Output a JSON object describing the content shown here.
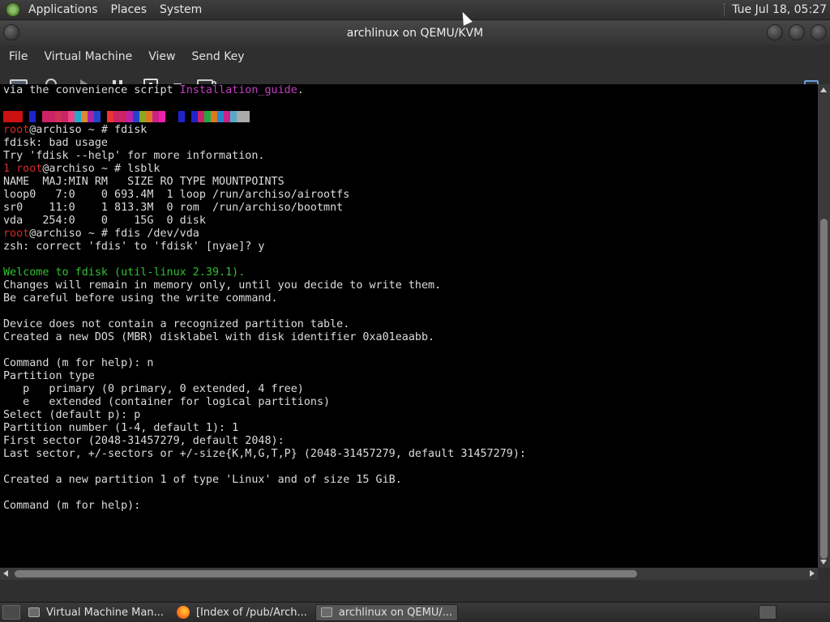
{
  "top_panel": {
    "menu": [
      "Applications",
      "Places",
      "System"
    ],
    "clock": "Tue Jul 18, 05:27"
  },
  "window": {
    "title": "archlinux on QEMU/KVM",
    "menu": [
      "File",
      "Virtual Machine",
      "View",
      "Send Key"
    ]
  },
  "toolbar": {
    "icons": [
      "monitor-icon",
      "lightbulb-icon",
      "play-icon",
      "pause-icon",
      "power-icon",
      "dropdown-caret-icon",
      "screenshot-icon",
      "fullscreen-icon"
    ]
  },
  "console": {
    "lines": [
      {
        "segments": [
          {
            "text": "via the convenience script "
          },
          {
            "text": "Installation_guide",
            "color": "magenta"
          },
          {
            "text": "."
          }
        ]
      },
      {
        "segments": [
          {
            "text": ""
          }
        ]
      },
      {
        "colorbar": [
          "#cc1111",
          "#cc1111",
          "#cc1111",
          "#000000",
          "#2222cc",
          "#000000",
          "#cc2266",
          "#cc2266",
          "#cc3355",
          "#cc2266",
          "#ee4488",
          "#22aacc",
          "#dd8833",
          "#aa22aa",
          "#2244cc",
          "#000000",
          "#ee3333",
          "#cc2266",
          "#cc2266",
          "#bb22aa",
          "#2244cc",
          "#88aa22",
          "#dd7722",
          "#cc2288",
          "#ee22aa",
          "#000000",
          "#000000",
          "#2222cc",
          "#000000",
          "#2222cc",
          "#cc2266",
          "#22aa44",
          "#dd7722",
          "#2288cc",
          "#cc2288",
          "#55aacc",
          "#aaaaaa",
          "#aaaaaa"
        ]
      },
      {
        "segments": [
          {
            "text": "root",
            "color": "red"
          },
          {
            "text": "@archiso ~ # fdisk"
          }
        ]
      },
      {
        "segments": [
          {
            "text": "fdisk: bad usage"
          }
        ]
      },
      {
        "segments": [
          {
            "text": "Try 'fdisk --help' for more information."
          }
        ]
      },
      {
        "segments": [
          {
            "text": "1 ",
            "color": "red"
          },
          {
            "text": "root",
            "color": "red"
          },
          {
            "text": "@archiso ~ # lsblk"
          }
        ]
      },
      {
        "segments": [
          {
            "text": "NAME  MAJ:MIN RM   SIZE RO TYPE MOUNTPOINTS"
          }
        ]
      },
      {
        "segments": [
          {
            "text": "loop0   7:0    0 693.4M  1 loop /run/archiso/airootfs"
          }
        ]
      },
      {
        "segments": [
          {
            "text": "sr0    11:0    1 813.3M  0 rom  /run/archiso/bootmnt"
          }
        ]
      },
      {
        "segments": [
          {
            "text": "vda   254:0    0    15G  0 disk"
          }
        ]
      },
      {
        "segments": [
          {
            "text": "root",
            "color": "red"
          },
          {
            "text": "@archiso ~ # fdis /dev/vda"
          }
        ]
      },
      {
        "segments": [
          {
            "text": "zsh: correct 'fdis' to 'fdisk' [nyae]? y"
          }
        ]
      },
      {
        "segments": [
          {
            "text": ""
          }
        ]
      },
      {
        "segments": [
          {
            "text": "Welcome to fdisk (util-linux 2.39.1).",
            "color": "green"
          }
        ]
      },
      {
        "segments": [
          {
            "text": "Changes will remain in memory only, until you decide to write them."
          }
        ]
      },
      {
        "segments": [
          {
            "text": "Be careful before using the write command."
          }
        ]
      },
      {
        "segments": [
          {
            "text": ""
          }
        ]
      },
      {
        "segments": [
          {
            "text": "Device does not contain a recognized partition table."
          }
        ]
      },
      {
        "segments": [
          {
            "text": "Created a new DOS (MBR) disklabel with disk identifier 0xa01eaabb."
          }
        ]
      },
      {
        "segments": [
          {
            "text": ""
          }
        ]
      },
      {
        "segments": [
          {
            "text": "Command (m for help): n"
          }
        ]
      },
      {
        "segments": [
          {
            "text": "Partition type"
          }
        ]
      },
      {
        "segments": [
          {
            "text": "   p   primary (0 primary, 0 extended, 4 free)"
          }
        ]
      },
      {
        "segments": [
          {
            "text": "   e   extended (container for logical partitions)"
          }
        ]
      },
      {
        "segments": [
          {
            "text": "Select (default p): p"
          }
        ]
      },
      {
        "segments": [
          {
            "text": "Partition number (1-4, default 1): 1"
          }
        ]
      },
      {
        "segments": [
          {
            "text": "First sector (2048-31457279, default 2048):"
          }
        ]
      },
      {
        "segments": [
          {
            "text": "Last sector, +/-sectors or +/-size{K,M,G,T,P} (2048-31457279, default 31457279):"
          }
        ]
      },
      {
        "segments": [
          {
            "text": ""
          }
        ]
      },
      {
        "segments": [
          {
            "text": "Created a new partition 1 of type 'Linux' and of size 15 GiB."
          }
        ]
      },
      {
        "segments": [
          {
            "text": ""
          }
        ]
      },
      {
        "segments": [
          {
            "text": "Command (m for help):"
          }
        ]
      }
    ]
  },
  "taskbar": {
    "tasks": [
      {
        "label": "Virtual Machine Man...",
        "icon": "vm-manager-icon",
        "active": false
      },
      {
        "label": "[Index of /pub/Arch...",
        "icon": "firefox-icon",
        "active": false
      },
      {
        "label": "archlinux on QEMU/...",
        "icon": "vm-console-icon",
        "active": true
      }
    ]
  },
  "colors": {
    "prompt_red": "#d62a2a",
    "link_magenta": "#c040c0",
    "welcome_green": "#30c030",
    "console_bg": "#000000",
    "console_fg": "#dcdcdc"
  }
}
